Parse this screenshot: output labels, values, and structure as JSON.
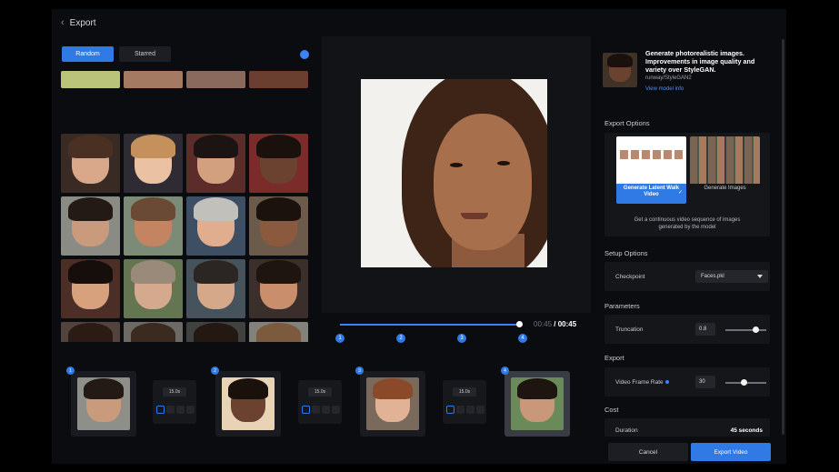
{
  "header": {
    "title": "Export",
    "back_icon": "chevron-left-icon"
  },
  "gallery": {
    "tabs": [
      {
        "label": "Random",
        "active": true
      },
      {
        "label": "Starred",
        "active": false
      }
    ]
  },
  "player": {
    "current_time": "00:45",
    "total_time": "/ 00:45",
    "progress": 1.0,
    "markers": [
      "1",
      "2",
      "3",
      "4"
    ]
  },
  "keyframes": {
    "frames": [
      "1",
      "2",
      "3",
      "4"
    ],
    "transitions": [
      "15.0s",
      "15.0s",
      "15.0s"
    ]
  },
  "model": {
    "title": "Generate photorealistic images. Improvements in image quality and variety over StyleGAN.",
    "path": "runway/StyleGAN2",
    "link": "View model info"
  },
  "export_options": {
    "heading": "Export Options",
    "option_video": "Generate Latent Walk Video",
    "option_images": "Generate Images",
    "description": "Get a continuous video sequence of images generated by the model"
  },
  "setup": {
    "heading": "Setup Options",
    "checkpoint_label": "Checkpoint",
    "checkpoint_value": "Faces.pkl"
  },
  "parameters": {
    "heading": "Parameters",
    "truncation_label": "Truncation",
    "truncation_value": "0.8",
    "truncation_level": 0.73
  },
  "export": {
    "heading": "Export",
    "frame_rate_label": "Video Frame Rate",
    "frame_rate_value": "30",
    "frame_rate_level": 0.45
  },
  "cost": {
    "heading": "Cost",
    "duration_label": "Duration",
    "duration_value": "45 seconds"
  },
  "actions": {
    "cancel": "Cancel",
    "export": "Export Video"
  },
  "colors": {
    "accent": "#2f7ae5",
    "background": "#0b0c0f",
    "panel": "#15161a"
  }
}
